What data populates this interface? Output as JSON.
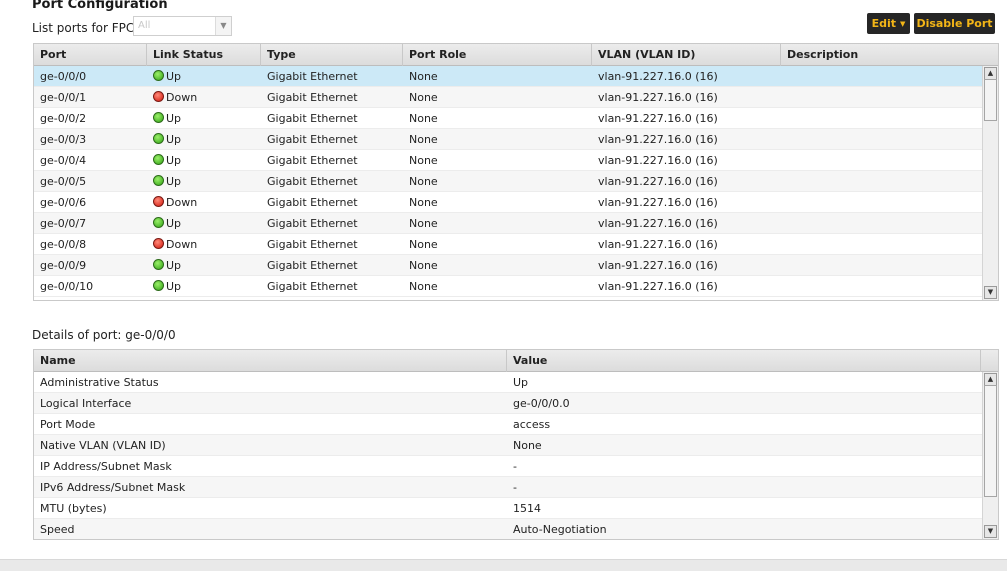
{
  "page": {
    "title": "Port Configuration",
    "fpc_label": "List ports for FPC:",
    "fpc_value": "All",
    "edit_label": "Edit",
    "disable_label": "Disable Port"
  },
  "ports_table": {
    "headers": [
      "Port",
      "Link Status",
      "Type",
      "Port Role",
      "VLAN (VLAN ID)",
      "Description"
    ],
    "rows": [
      {
        "port": "ge-0/0/0",
        "status": "Up",
        "type": "Gigabit Ethernet",
        "role": "None",
        "vlan": "vlan-91.227.16.0 (16)",
        "desc": ""
      },
      {
        "port": "ge-0/0/1",
        "status": "Down",
        "type": "Gigabit Ethernet",
        "role": "None",
        "vlan": "vlan-91.227.16.0 (16)",
        "desc": ""
      },
      {
        "port": "ge-0/0/2",
        "status": "Up",
        "type": "Gigabit Ethernet",
        "role": "None",
        "vlan": "vlan-91.227.16.0 (16)",
        "desc": ""
      },
      {
        "port": "ge-0/0/3",
        "status": "Up",
        "type": "Gigabit Ethernet",
        "role": "None",
        "vlan": "vlan-91.227.16.0 (16)",
        "desc": ""
      },
      {
        "port": "ge-0/0/4",
        "status": "Up",
        "type": "Gigabit Ethernet",
        "role": "None",
        "vlan": "vlan-91.227.16.0 (16)",
        "desc": ""
      },
      {
        "port": "ge-0/0/5",
        "status": "Up",
        "type": "Gigabit Ethernet",
        "role": "None",
        "vlan": "vlan-91.227.16.0 (16)",
        "desc": ""
      },
      {
        "port": "ge-0/0/6",
        "status": "Down",
        "type": "Gigabit Ethernet",
        "role": "None",
        "vlan": "vlan-91.227.16.0 (16)",
        "desc": ""
      },
      {
        "port": "ge-0/0/7",
        "status": "Up",
        "type": "Gigabit Ethernet",
        "role": "None",
        "vlan": "vlan-91.227.16.0 (16)",
        "desc": ""
      },
      {
        "port": "ge-0/0/8",
        "status": "Down",
        "type": "Gigabit Ethernet",
        "role": "None",
        "vlan": "vlan-91.227.16.0 (16)",
        "desc": ""
      },
      {
        "port": "ge-0/0/9",
        "status": "Up",
        "type": "Gigabit Ethernet",
        "role": "None",
        "vlan": "vlan-91.227.16.0 (16)",
        "desc": ""
      },
      {
        "port": "ge-0/0/10",
        "status": "Up",
        "type": "Gigabit Ethernet",
        "role": "None",
        "vlan": "vlan-91.227.16.0 (16)",
        "desc": ""
      }
    ],
    "selected_index": 0
  },
  "details": {
    "label": "Details of port: ge-0/0/0",
    "headers": [
      "Name",
      "Value"
    ],
    "rows": [
      {
        "name": "Administrative Status",
        "value": "Up"
      },
      {
        "name": "Logical Interface",
        "value": "ge-0/0/0.0"
      },
      {
        "name": "Port Mode",
        "value": "access"
      },
      {
        "name": "Native VLAN (VLAN ID)",
        "value": "None"
      },
      {
        "name": "IP Address/Subnet Mask",
        "value": "-"
      },
      {
        "name": "IPv6 Address/Subnet Mask",
        "value": "-"
      },
      {
        "name": "MTU (bytes)",
        "value": "1514"
      },
      {
        "name": "Speed",
        "value": "Auto-Negotiation"
      }
    ]
  },
  "colors": {
    "accent_text": "#f2b517",
    "button_bg": "#262626",
    "selected_row": "#cce9f7",
    "status_up": "#2fa312",
    "status_down": "#d1160a"
  },
  "icons": {
    "status_up": "green-circle-icon",
    "status_down": "red-circle-icon",
    "dropdown": "caret-down-icon",
    "scroll_up": "arrow-up-icon",
    "scroll_down": "arrow-down-icon"
  }
}
